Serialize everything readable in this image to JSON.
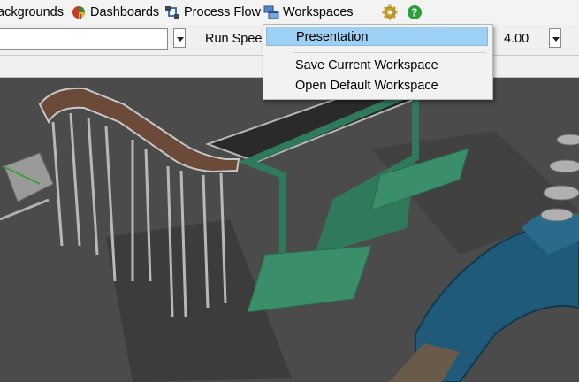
{
  "toolbar": {
    "items": [
      {
        "label": "ackgrounds"
      },
      {
        "label": "Dashboards"
      },
      {
        "label": "Process Flow"
      },
      {
        "label": "Workspaces"
      }
    ]
  },
  "controls": {
    "run_speed_label": "Run Speed",
    "run_speed_value": "4.00"
  },
  "workspaces_menu": {
    "items": [
      {
        "label": "Presentation",
        "highlighted": true
      },
      {
        "label": "Save Current Workspace"
      },
      {
        "label": "Open Default Workspace"
      }
    ]
  },
  "colors": {
    "menu_highlight": "#9dd0f2",
    "toolbar_bg": "#f3f3f3",
    "conveyor_green": "#2f7a5a",
    "conveyor_brown": "#6b4a3a",
    "robot_blue": "#1f5a78",
    "help_icon": "#2e9e3a",
    "settings_icon": "#c8a028"
  },
  "icons": [
    "dashboards-icon",
    "process-flow-icon",
    "workspaces-icon",
    "settings-icon",
    "help-icon"
  ]
}
